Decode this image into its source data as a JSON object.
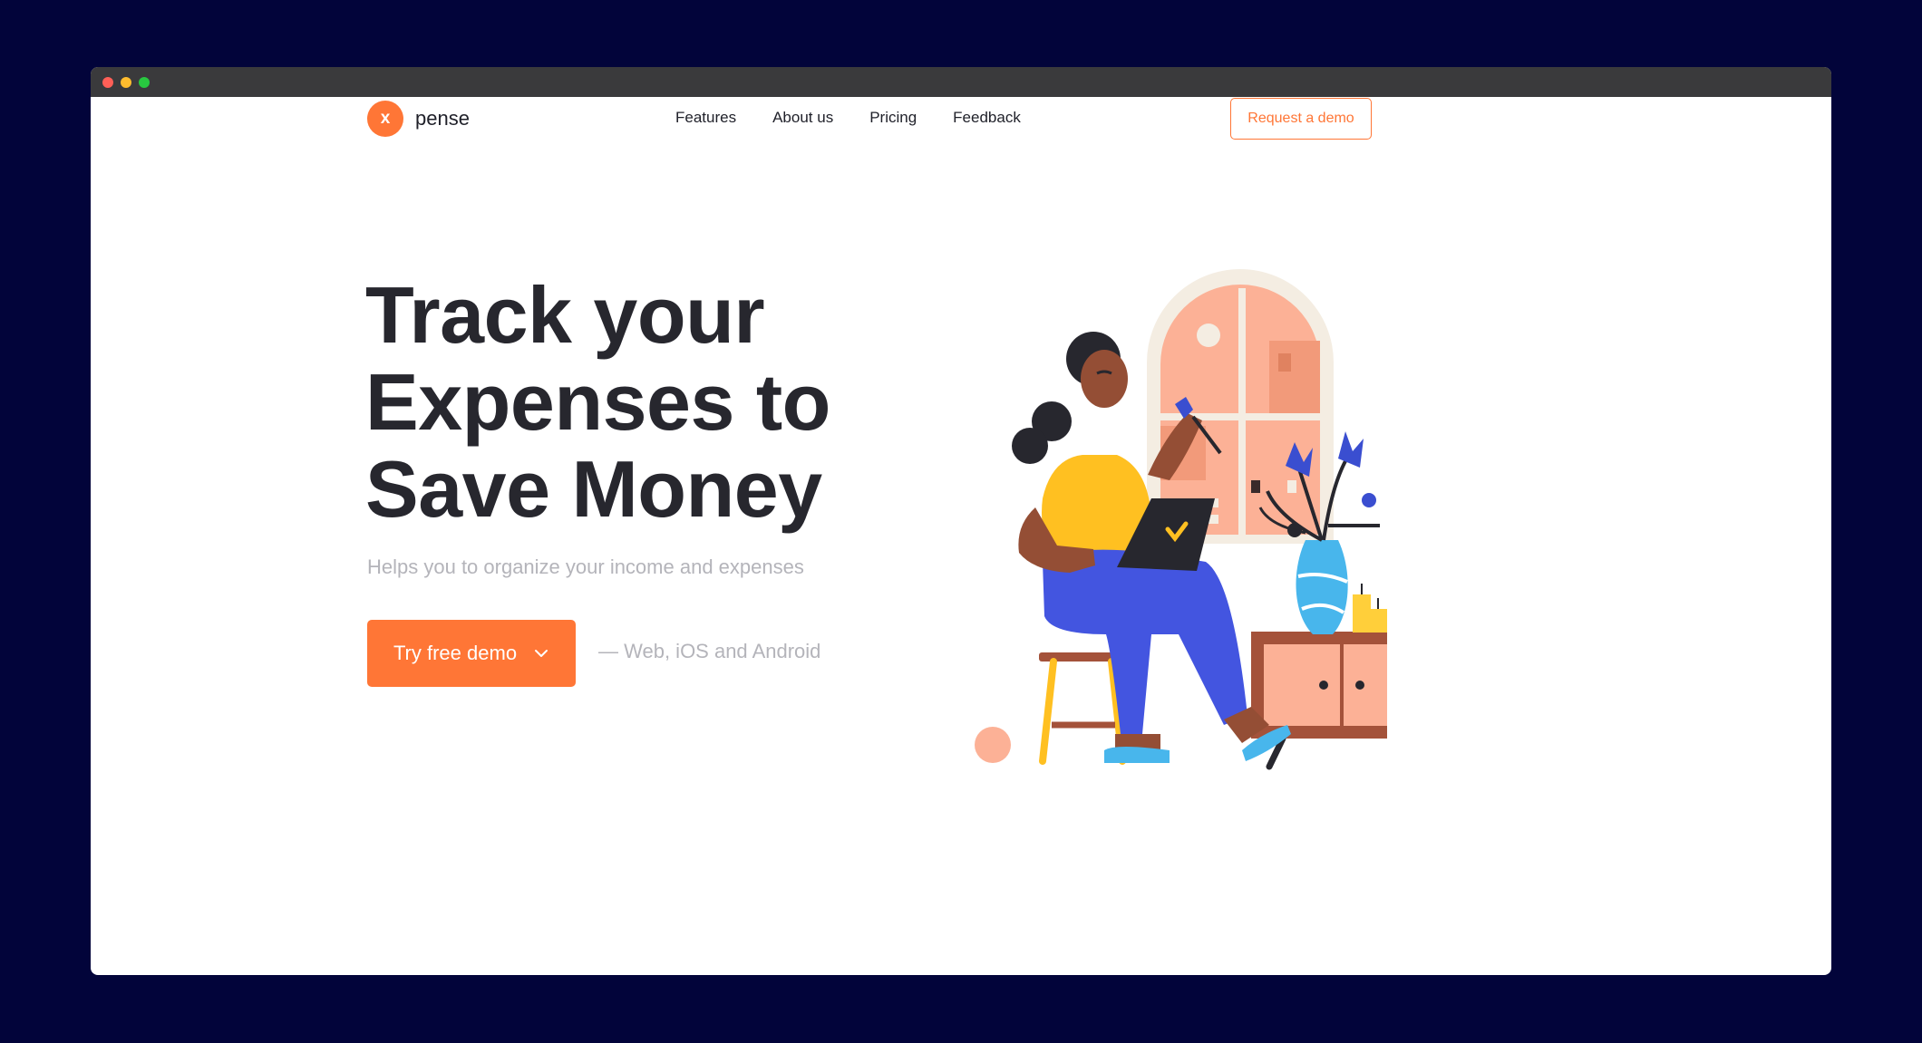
{
  "brand": {
    "logo_letter": "x",
    "name": "pense",
    "accent_color": "#ff7636"
  },
  "nav": {
    "items": [
      {
        "label": "Features"
      },
      {
        "label": "About us"
      },
      {
        "label": "Pricing"
      },
      {
        "label": "Feedback"
      }
    ],
    "demo_button_label": "Request a demo"
  },
  "hero": {
    "headline_lines": [
      "Track your",
      "Expenses to",
      "Save Money"
    ],
    "subtitle": "Helps you to organize your income and expenses",
    "cta_label": "Try free demo",
    "cta_icon": "chevron-down-icon",
    "platforms": "— Web, iOS and Android"
  },
  "illustration": {
    "subject": "woman-with-laptop-illustration"
  }
}
